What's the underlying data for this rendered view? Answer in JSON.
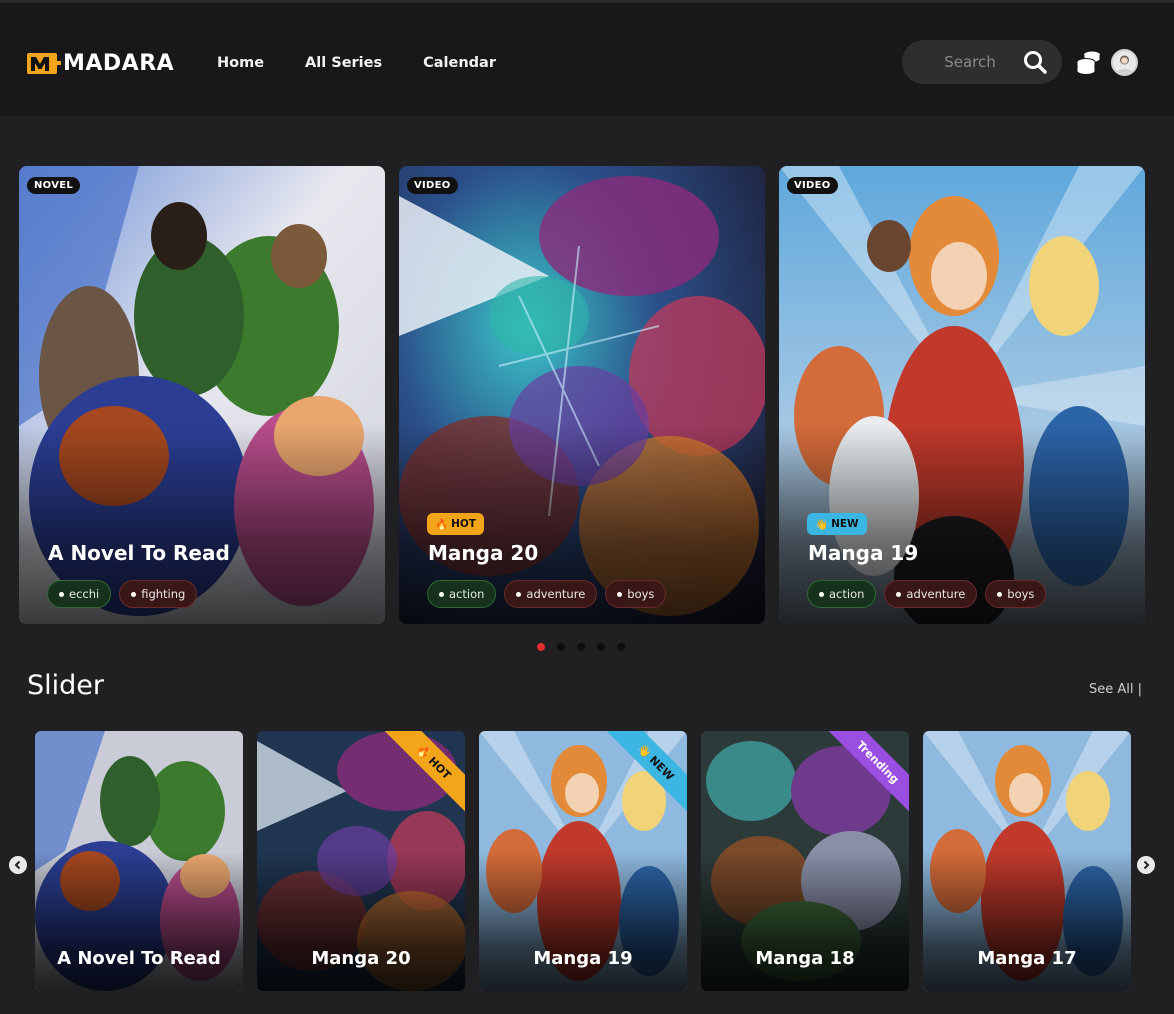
{
  "brand": {
    "name": "MADARA",
    "mark_letter": "M",
    "color": "#f3a51a"
  },
  "nav": {
    "items": [
      "Home",
      "All Series",
      "Calendar"
    ]
  },
  "search": {
    "placeholder": "Search",
    "value": ""
  },
  "header_icons": {
    "coins": "coins-icon",
    "avatar": "avatar"
  },
  "hero": {
    "cards": [
      {
        "type": "NOVEL",
        "flag": "",
        "title": "A Novel To Read",
        "tags": [
          "ecchi",
          "fighting"
        ]
      },
      {
        "type": "VIDEO",
        "flag": "HOT",
        "flag_icon": "🔥",
        "title": "Manga 20",
        "tags": [
          "action",
          "adventure",
          "boys"
        ]
      },
      {
        "type": "VIDEO",
        "flag": "NEW",
        "flag_icon": "👋",
        "title": "Manga 19",
        "tags": [
          "action",
          "adventure",
          "boys"
        ]
      }
    ],
    "pagination": {
      "count": 5,
      "active": 1
    }
  },
  "slider": {
    "title": "Slider",
    "see_all": "See All |",
    "items": [
      {
        "title": "A Novel To Read",
        "ribbon": ""
      },
      {
        "title": "Manga 20",
        "ribbon": "HOT",
        "ribbon_icon": "🔥"
      },
      {
        "title": "Manga 19",
        "ribbon": "NEW",
        "ribbon_icon": "👋"
      },
      {
        "title": "Manga 18",
        "ribbon": "Trending"
      },
      {
        "title": "Manga 17",
        "ribbon": ""
      }
    ]
  },
  "colors": {
    "accent_red": "#e02d2d",
    "hot": "#f3a51a",
    "new": "#3bb5e2",
    "trending": "#9b4fe0"
  }
}
